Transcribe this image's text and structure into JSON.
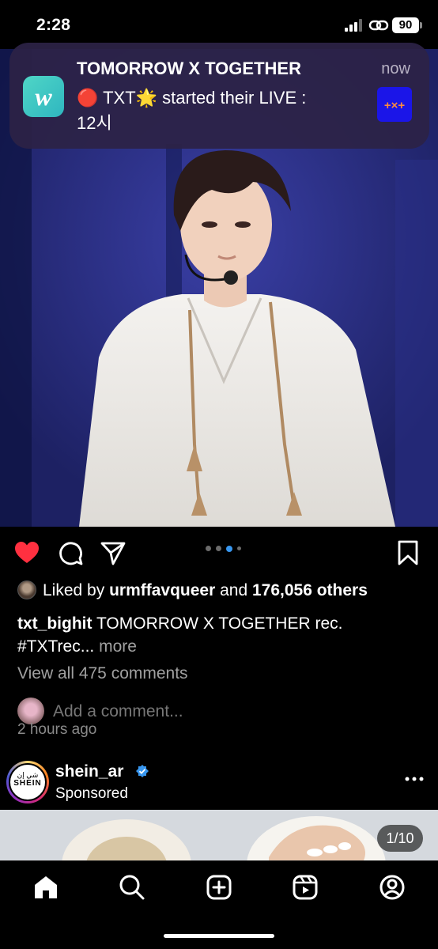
{
  "status_bar": {
    "time": "2:28",
    "battery": "90"
  },
  "notification": {
    "app_icon": "weverse-app-icon",
    "title": "TOMORROW X TOGETHER",
    "time": "now",
    "body_line1": "🔴 TXT🌟 started their LIVE :",
    "body_line2": "12시",
    "thumbnail_text": "+×+"
  },
  "post": {
    "carousel": {
      "count": 5,
      "active_index": 2
    },
    "likes": {
      "prefix": "Liked by ",
      "user": "urmffavqueer",
      "middle": " and ",
      "count_text": "176,056 others"
    },
    "caption": {
      "username": "txt_bighit",
      "text": " TOMORROW X TOGETHER rec. #TXTrec...",
      "more": " more"
    },
    "view_comments": "View all 475 comments",
    "add_comment_placeholder": "Add a comment...",
    "timestamp": "2 hours ago"
  },
  "sponsored_post": {
    "username": "shein_ar",
    "verified": true,
    "label": "Sponsored",
    "avatar_arabic": "شي إن",
    "avatar_latin": "SHEIN",
    "media_counter": "1/10"
  },
  "tab_bar": {
    "items": [
      "home-icon",
      "search-icon",
      "create-icon",
      "reels-icon",
      "profile-icon"
    ],
    "active": "home-icon"
  },
  "colors": {
    "like_red": "#ff3040",
    "verified_blue": "#3897f0",
    "active_dot": "#3897f0"
  }
}
